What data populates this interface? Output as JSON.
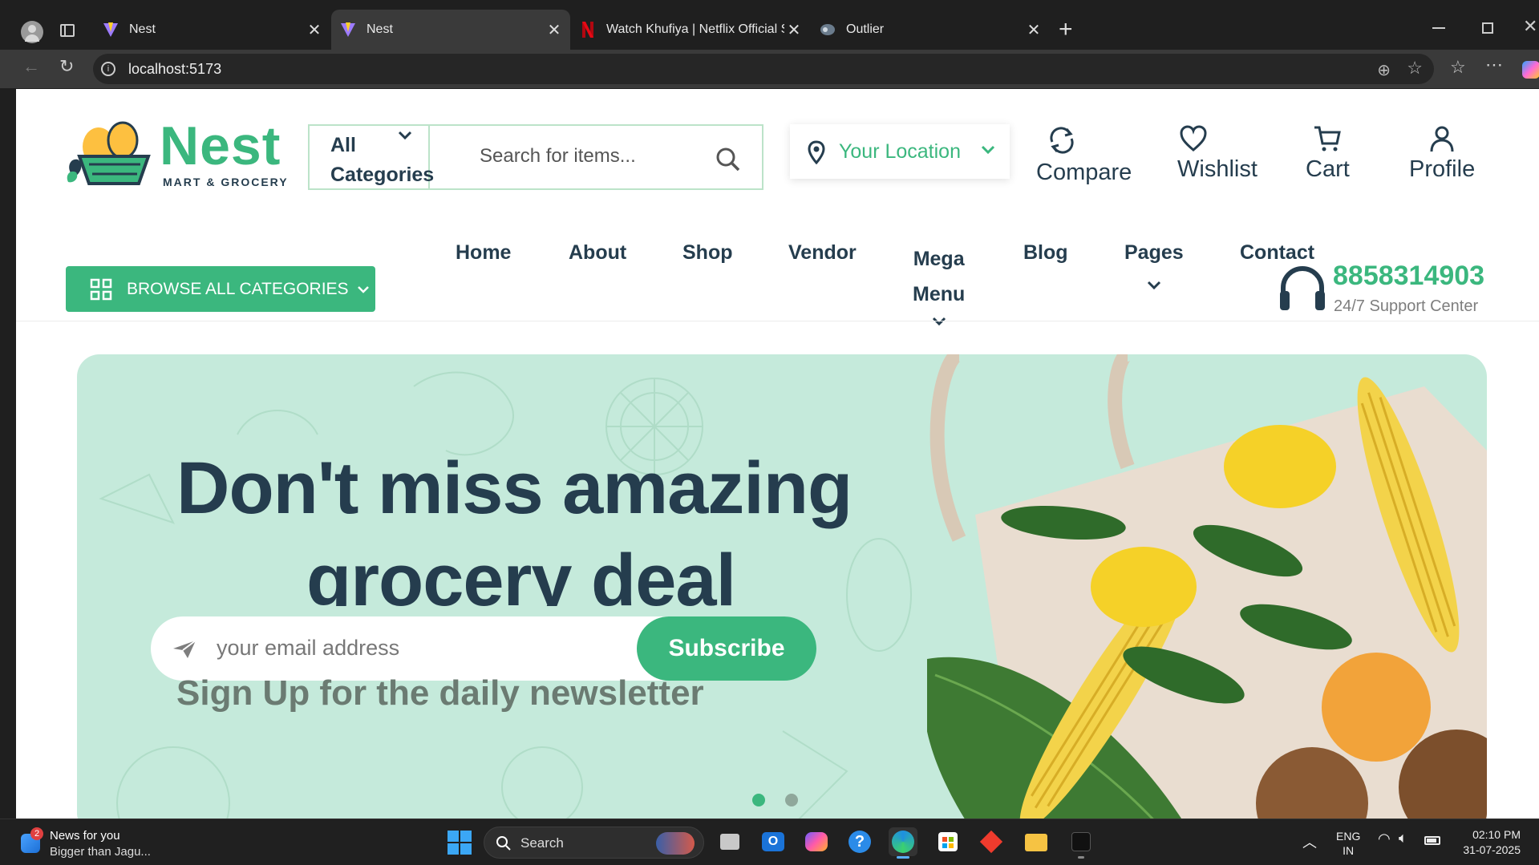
{
  "browser": {
    "tabs": [
      {
        "title": "Nest",
        "icon": "vite-icon"
      },
      {
        "title": "Nest",
        "icon": "vite-icon",
        "active": true
      },
      {
        "title": "Watch Khufiya | Netflix Official Sit",
        "icon": "netflix-icon"
      },
      {
        "title": "Outlier",
        "icon": "outlier-icon"
      }
    ],
    "url": "localhost:5173"
  },
  "header": {
    "logo_name": "Nest",
    "logo_tagline": "MART & GROCERY",
    "category_select": {
      "line1": "All",
      "line2": "Categories"
    },
    "search_placeholder": "Search for items...",
    "location_label": "Your Location",
    "actions": {
      "compare": "Compare",
      "wishlist": "Wishlist",
      "cart": "Cart",
      "profile": "Profile"
    }
  },
  "nav": {
    "browse_label": "BROWSE ALL CATEGORIES",
    "links": {
      "home": "Home",
      "about": "About",
      "shop": "Shop",
      "vendor": "Vendor",
      "mega_1": "Mega",
      "mega_2": "Menu",
      "blog": "Blog",
      "pages": "Pages",
      "contact": "Contact"
    },
    "phone": "8858314903",
    "support": "24/7 Support Center"
  },
  "hero": {
    "headline_1": "Don't miss amazing",
    "headline_2": "grocery deal",
    "email_placeholder": "your email address",
    "subscribe_label": "Subscribe",
    "subtext": "Sign Up for the daily newsletter",
    "slides": 2,
    "active_slide": 1
  },
  "taskbar": {
    "news_title": "News for you",
    "news_sub": "Bigger than Jagu...",
    "news_badge": "2",
    "search_label": "Search",
    "lang_1": "ENG",
    "lang_2": "IN",
    "time": "02:10 PM",
    "date": "31-07-2025"
  },
  "colors": {
    "brand": "#3bb77e",
    "heading": "#253d4e",
    "hero_bg": "#c5eadb",
    "muted": "#7e7e7e"
  }
}
